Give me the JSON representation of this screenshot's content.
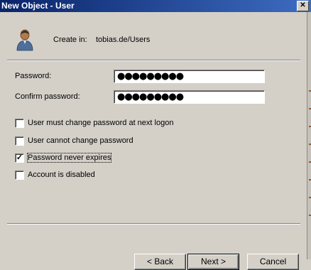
{
  "window": {
    "title": "New Object - User",
    "close_glyph": "✕"
  },
  "header": {
    "icon": "user-icon",
    "create_in_label": "Create in:",
    "create_in_path": "tobias.de/Users"
  },
  "form": {
    "password_label": "Password:",
    "password_value": "●●●●●●●●●",
    "confirm_label": "Confirm password:",
    "confirm_value": "●●●●●●●●●"
  },
  "options": [
    {
      "label": "User must change password at next logon",
      "checked": false
    },
    {
      "label": "User cannot change password",
      "checked": false
    },
    {
      "label": "Password never expires",
      "checked": true
    },
    {
      "label": "Account is disabled",
      "checked": false
    }
  ],
  "buttons": {
    "back": "< Back",
    "next": "Next >",
    "cancel": "Cancel"
  }
}
